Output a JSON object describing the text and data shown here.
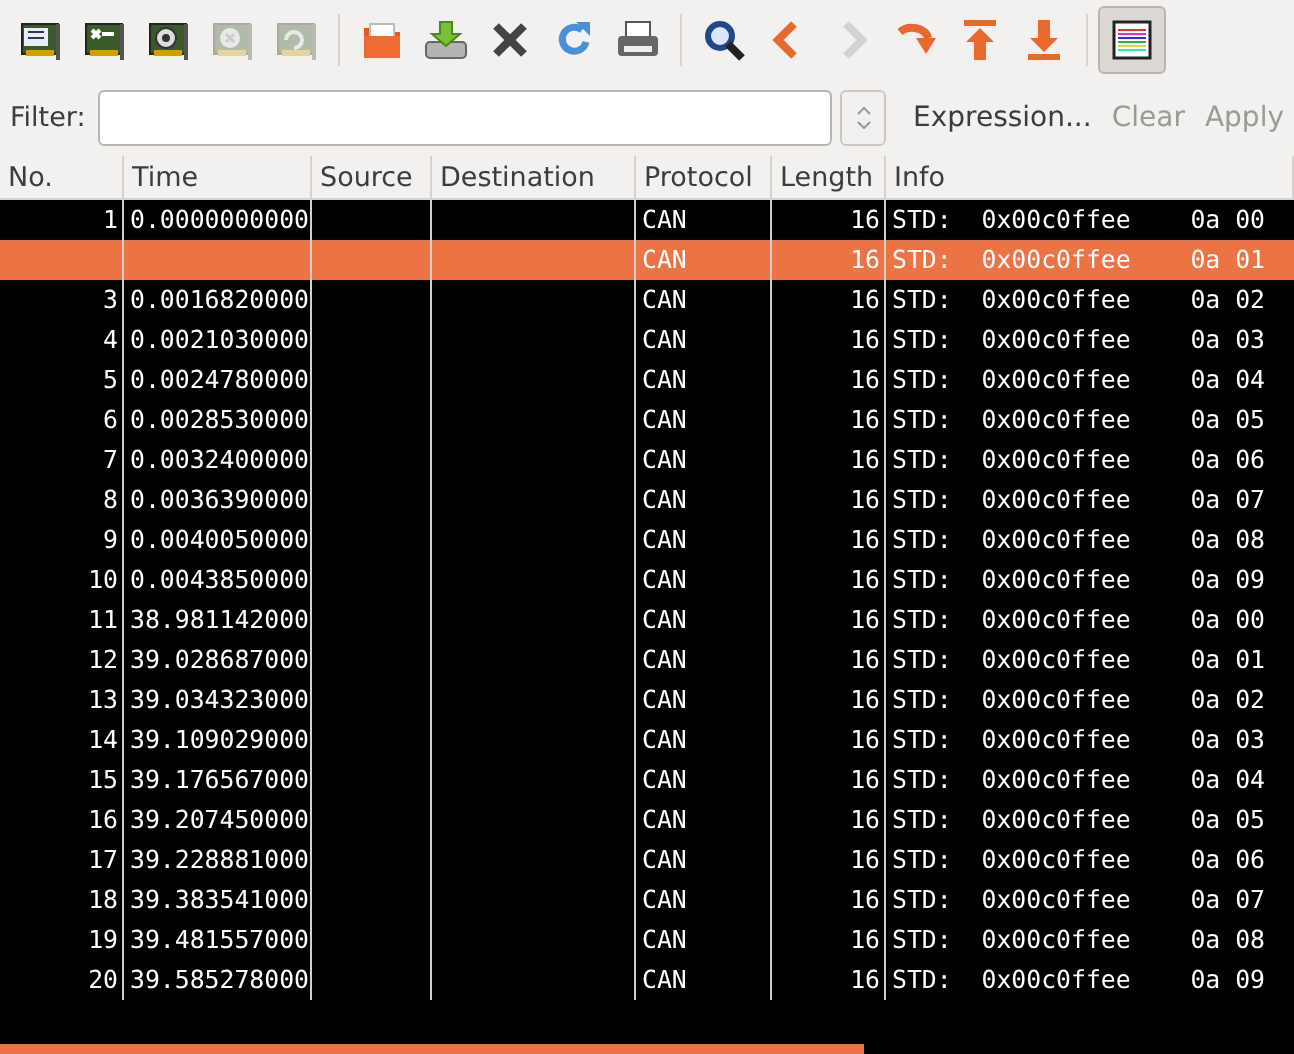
{
  "toolbar": [
    {
      "kind": "interfaces",
      "disabled": false
    },
    {
      "kind": "options",
      "disabled": false
    },
    {
      "kind": "start",
      "disabled": false
    },
    {
      "kind": "stop",
      "disabled": true
    },
    {
      "kind": "restart",
      "disabled": true
    },
    {
      "kind": "separator"
    },
    {
      "kind": "open",
      "disabled": false
    },
    {
      "kind": "save",
      "disabled": false
    },
    {
      "kind": "close",
      "disabled": false
    },
    {
      "kind": "reload",
      "disabled": false
    },
    {
      "kind": "print",
      "disabled": false
    },
    {
      "kind": "separator"
    },
    {
      "kind": "find",
      "disabled": false
    },
    {
      "kind": "back",
      "disabled": false
    },
    {
      "kind": "forward",
      "disabled": true
    },
    {
      "kind": "goto",
      "disabled": false
    },
    {
      "kind": "first",
      "disabled": false
    },
    {
      "kind": "last",
      "disabled": false
    },
    {
      "kind": "separator"
    },
    {
      "kind": "colorize",
      "disabled": false,
      "pressed": true
    }
  ],
  "filter": {
    "label": "Filter:",
    "buttons": [
      {
        "label": "Expression...",
        "disabled": false
      },
      {
        "label": "Clear",
        "disabled": true
      },
      {
        "label": "Apply",
        "disabled": true
      }
    ]
  },
  "columns": [
    "No.",
    "Time",
    "Source",
    "Destination",
    "Protocol",
    "Length",
    "Info"
  ],
  "rows": [
    {
      "no": "1",
      "time": "0.0000000000",
      "protocol": "CAN",
      "length": "16",
      "info": "STD:  0x00c0ffee    0a 00",
      "selected": false
    },
    {
      "protocol": "CAN",
      "length": "16",
      "info": "STD:  0x00c0ffee    0a 01",
      "selected": true
    },
    {
      "no": "3",
      "time": "0.0016820000",
      "protocol": "CAN",
      "length": "16",
      "info": "STD:  0x00c0ffee    0a 02",
      "selected": false
    },
    {
      "no": "4",
      "time": "0.0021030000",
      "protocol": "CAN",
      "length": "16",
      "info": "STD:  0x00c0ffee    0a 03",
      "selected": false
    },
    {
      "no": "5",
      "time": "0.0024780000",
      "protocol": "CAN",
      "length": "16",
      "info": "STD:  0x00c0ffee    0a 04",
      "selected": false
    },
    {
      "no": "6",
      "time": "0.0028530000",
      "protocol": "CAN",
      "length": "16",
      "info": "STD:  0x00c0ffee    0a 05",
      "selected": false
    },
    {
      "no": "7",
      "time": "0.0032400000",
      "protocol": "CAN",
      "length": "16",
      "info": "STD:  0x00c0ffee    0a 06",
      "selected": false
    },
    {
      "no": "8",
      "time": "0.0036390000",
      "protocol": "CAN",
      "length": "16",
      "info": "STD:  0x00c0ffee    0a 07",
      "selected": false
    },
    {
      "no": "9",
      "time": "0.0040050000",
      "protocol": "CAN",
      "length": "16",
      "info": "STD:  0x00c0ffee    0a 08",
      "selected": false
    },
    {
      "no": "10",
      "time": "0.0043850000",
      "protocol": "CAN",
      "length": "16",
      "info": "STD:  0x00c0ffee    0a 09",
      "selected": false
    },
    {
      "no": "11",
      "time": "38.981142000",
      "protocol": "CAN",
      "length": "16",
      "info": "STD:  0x00c0ffee    0a 00",
      "selected": false
    },
    {
      "no": "12",
      "time": "39.028687000",
      "protocol": "CAN",
      "length": "16",
      "info": "STD:  0x00c0ffee    0a 01",
      "selected": false
    },
    {
      "no": "13",
      "time": "39.034323000",
      "protocol": "CAN",
      "length": "16",
      "info": "STD:  0x00c0ffee    0a 02",
      "selected": false
    },
    {
      "no": "14",
      "time": "39.109029000",
      "protocol": "CAN",
      "length": "16",
      "info": "STD:  0x00c0ffee    0a 03",
      "selected": false
    },
    {
      "no": "15",
      "time": "39.176567000",
      "protocol": "CAN",
      "length": "16",
      "info": "STD:  0x00c0ffee    0a 04",
      "selected": false
    },
    {
      "no": "16",
      "time": "39.207450000",
      "protocol": "CAN",
      "length": "16",
      "info": "STD:  0x00c0ffee    0a 05",
      "selected": false
    },
    {
      "no": "17",
      "time": "39.228881000",
      "protocol": "CAN",
      "length": "16",
      "info": "STD:  0x00c0ffee    0a 06",
      "selected": false
    },
    {
      "no": "18",
      "time": "39.383541000",
      "protocol": "CAN",
      "length": "16",
      "info": "STD:  0x00c0ffee    0a 07",
      "selected": false
    },
    {
      "no": "19",
      "time": "39.481557000",
      "protocol": "CAN",
      "length": "16",
      "info": "STD:  0x00c0ffee    0a 08",
      "selected": false
    },
    {
      "no": "20",
      "time": "39.585278000",
      "protocol": "CAN",
      "length": "16",
      "info": "STD:  0x00c0ffee    0a 09",
      "selected": false
    }
  ]
}
